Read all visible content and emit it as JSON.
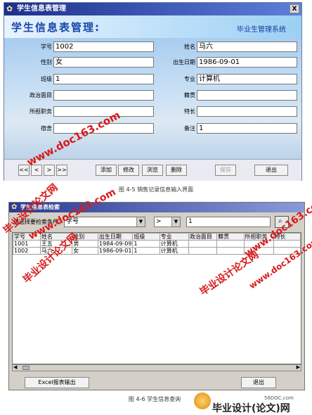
{
  "window1": {
    "title": "学生信息表管理",
    "close": "X",
    "banner_title": "学生信息表管理:",
    "banner_subtitle": "毕业生管理系统",
    "fields": {
      "left": [
        {
          "label": "学号",
          "value": "1002"
        },
        {
          "label": "性别",
          "value": "女"
        },
        {
          "label": "班级",
          "value": "1"
        },
        {
          "label": "政治面目",
          "value": ""
        },
        {
          "label": "所担职务",
          "value": ""
        },
        {
          "label": "宿舍",
          "value": ""
        }
      ],
      "right": [
        {
          "label": "姓名",
          "value": "马六"
        },
        {
          "label": "出生日期",
          "value": "1986-09-01"
        },
        {
          "label": "专业",
          "value": "计算机"
        },
        {
          "label": "籍贯",
          "value": ""
        },
        {
          "label": "特长",
          "value": ""
        },
        {
          "label": "备注",
          "value": "1"
        }
      ]
    },
    "nav": [
      "<<",
      "<",
      ">",
      ">>"
    ],
    "buttons": {
      "add": "添加",
      "edit": "修改",
      "browse": "浏览",
      "delete": "删除",
      "save": "保存",
      "exit": "退出"
    }
  },
  "caption1": "图 4-5 销售记录信息输入界面",
  "window2": {
    "title": "学生信息表检索",
    "condition_label": "请选择要检索条件:",
    "field_select": "学号",
    "operator_select": ">",
    "search_value": "1",
    "columns": [
      "学号",
      "姓名",
      "性别",
      "出生日期",
      "班级",
      "专业",
      "政治面目",
      "籍贯",
      "所担职务",
      "特长"
    ],
    "rows": [
      [
        "1001",
        "王五",
        "男",
        "1984-09-09",
        "1",
        "计算机",
        "",
        "",
        "",
        ""
      ],
      [
        "1002",
        "马六",
        "女",
        "1986-09-01",
        "1",
        "计算机",
        "",
        "",
        "",
        ""
      ]
    ],
    "excel_button": "Excel报表输出",
    "exit_button": "退出"
  },
  "caption2": "图 4-6 学生信息查询",
  "watermarks": {
    "wm1": "www.doc163.com",
    "wm2": "毕业设计论文网",
    "wm3": "www.doc163.com",
    "wm4": "毕业设计论文网",
    "wm5": "www.doc163.com",
    "wm6": "毕业设计论文网",
    "wm7": "www.doc163.com"
  },
  "footer": {
    "site": "56DOC.com",
    "brand": "毕业设计(论文)网"
  }
}
